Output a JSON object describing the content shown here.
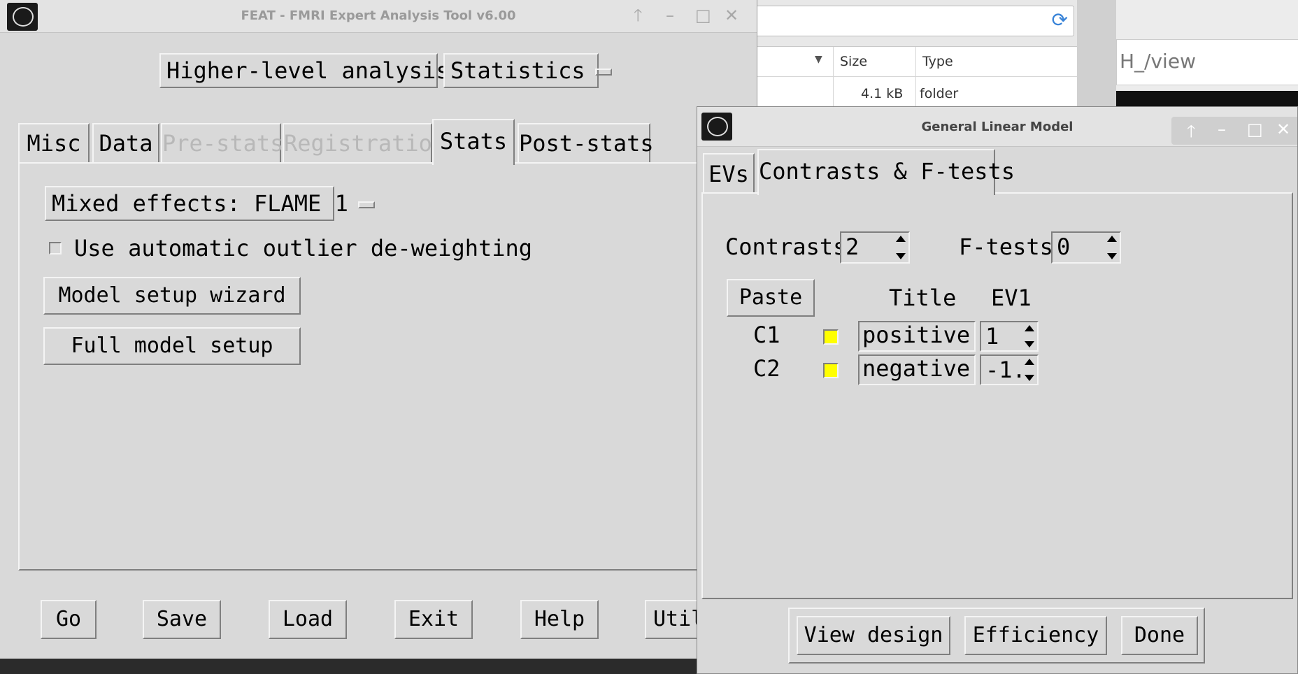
{
  "feat": {
    "title": "FEAT - FMRI Expert Analysis Tool v6.00",
    "analysis_level": "Higher-level analysis",
    "analysis_stage": "Statistics",
    "tabs": [
      "Misc",
      "Data",
      "Pre-stats",
      "Registration",
      "Stats",
      "Post-stats"
    ],
    "active_tab": "Stats",
    "stats": {
      "mixed_effects": "Mixed effects: FLAME 1",
      "outlier_label": "Use automatic outlier de-weighting",
      "outlier_checked": false,
      "wizard_button": "Model setup wizard",
      "full_model_button": "Full model setup"
    },
    "bottom_buttons": {
      "go": "Go",
      "save": "Save",
      "load": "Load",
      "exit": "Exit",
      "help": "Help",
      "utils": "Util"
    }
  },
  "file_manager": {
    "columns": {
      "size": "Size",
      "type": "Type"
    },
    "row": {
      "size": "4.1 kB",
      "type": "folder"
    },
    "path_fragment": "H_/view"
  },
  "glm": {
    "title": "General Linear Model",
    "tabs": [
      "EVs",
      "Contrasts & F-tests"
    ],
    "active_tab": "Contrasts & F-tests",
    "contrasts_label": "Contrasts",
    "contrasts_value": "2",
    "ftests_label": "F-tests",
    "ftests_value": "0",
    "paste_button": "Paste",
    "col_title": "Title",
    "col_ev1": "EV1",
    "rows": [
      {
        "id": "C1",
        "title": "positive",
        "ev1": "1"
      },
      {
        "id": "C2",
        "title": "negative",
        "ev1": "-1."
      }
    ],
    "buttons": {
      "view_design": "View design",
      "efficiency": "Efficiency",
      "done": "Done"
    }
  },
  "colors": {
    "tk_bg": "#d9d9d9",
    "contrast_checkbox": "#ffff00",
    "refresh_icon": "#3a84d8"
  }
}
